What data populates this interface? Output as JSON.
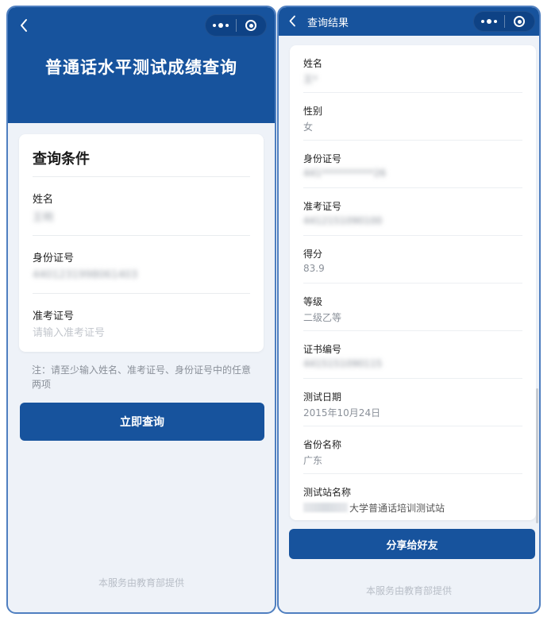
{
  "left": {
    "header_title": "普通话水平测试成绩查询",
    "form_title": "查询条件",
    "fields": [
      {
        "label": "姓名",
        "value": "王明"
      },
      {
        "label": "身份证号",
        "value": "4401231998061403"
      },
      {
        "label": "准考证号",
        "value": "",
        "placeholder": "请输入准考证号"
      }
    ],
    "note": "注：请至少输入姓名、准考证号、身份证号中的任意两项",
    "query_button": "立即查询",
    "footer": "本服务由教育部提供"
  },
  "right": {
    "header_title": "查询结果",
    "rows": [
      {
        "label": "姓名",
        "value": "王*"
      },
      {
        "label": "性别",
        "value": "女"
      },
      {
        "label": "身份证号",
        "value": "441***********26"
      },
      {
        "label": "准考证号",
        "value": "4412151090100"
      },
      {
        "label": "得分",
        "value": "83.9"
      },
      {
        "label": "等级",
        "value": "二级乙等"
      },
      {
        "label": "证书编号",
        "value": "4415151090115"
      },
      {
        "label": "测试日期",
        "value": "2015年10月24日"
      },
      {
        "label": "省份名称",
        "value": "广东"
      },
      {
        "label": "测试站名称",
        "value": "大学普通话培训测试站"
      }
    ],
    "share_button": "分享给好友",
    "footer": "本服务由教育部提供"
  },
  "icons": {
    "back": "chevron-left-icon",
    "more": "more-dots-icon",
    "close": "target-close-icon"
  },
  "colors": {
    "brand": "#17539d",
    "background": "#eef2f8"
  }
}
